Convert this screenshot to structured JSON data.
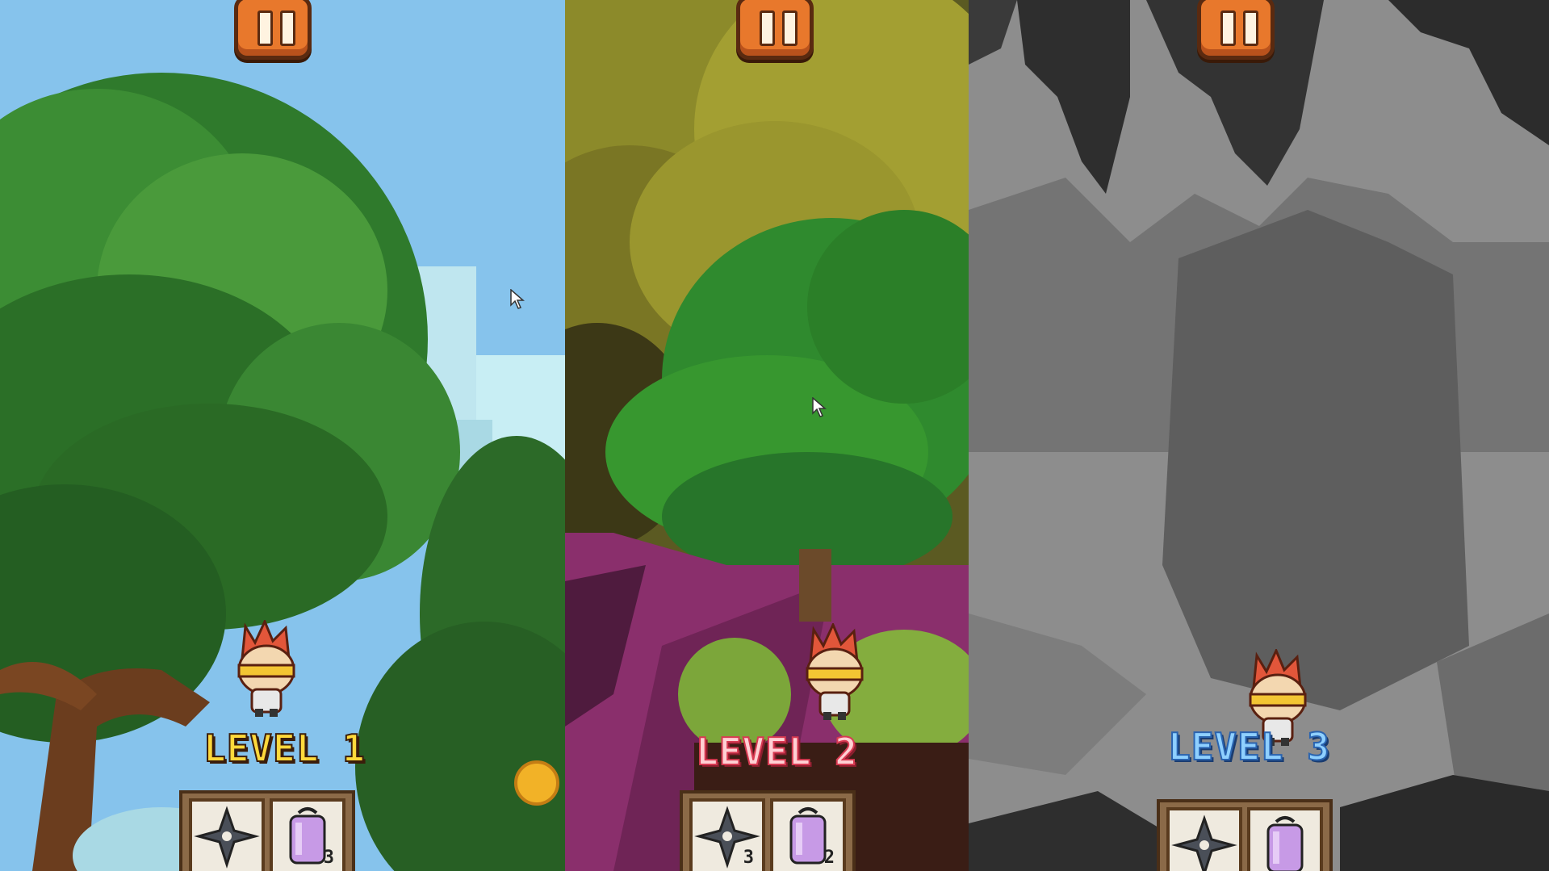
{
  "levels": [
    {
      "label": "LEVEL 1",
      "label_color": "#ffd93b",
      "theme": "forest",
      "items": [
        {
          "icon": "shuriken-icon",
          "count": ""
        },
        {
          "icon": "potion-jar-icon",
          "count": "3"
        }
      ]
    },
    {
      "label": "LEVEL 2",
      "label_color": "#ffd0d4",
      "theme": "jungle",
      "items": [
        {
          "icon": "shuriken-icon",
          "count": "3"
        },
        {
          "icon": "potion-jar-icon",
          "count": "2"
        }
      ]
    },
    {
      "label": "LEVEL 3",
      "label_color": "#8fd0ff",
      "theme": "cave",
      "items": [
        {
          "icon": "shuriken-icon",
          "count": ""
        },
        {
          "icon": "potion-jar-icon",
          "count": ""
        }
      ]
    }
  ],
  "controls": {
    "pause_icon": "pause-icon"
  },
  "colors": {
    "pause_button": "#e8782c",
    "sky": "#7fc0ea",
    "cave_wall": "#8a8a8a"
  }
}
